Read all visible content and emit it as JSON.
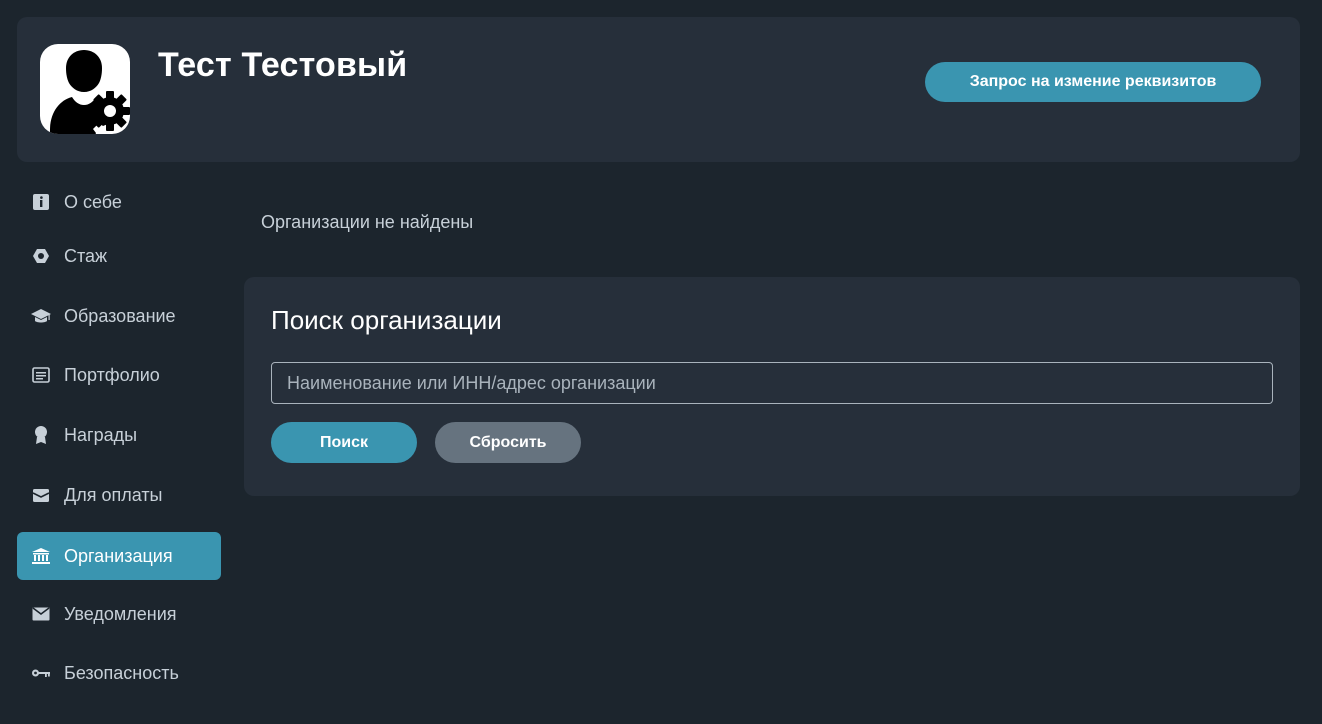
{
  "header": {
    "user_name": "Тест Тестовый",
    "request_button": "Запрос на измение реквизитов",
    "avatar_icon": "user-settings-icon"
  },
  "sidebar": {
    "items": [
      {
        "label": "О себе",
        "icon": "info-icon"
      },
      {
        "label": "Стаж",
        "icon": "hexagon-icon"
      },
      {
        "label": "Образование",
        "icon": "graduation-cap-icon"
      },
      {
        "label": "Портфолио",
        "icon": "document-icon"
      },
      {
        "label": "Награды",
        "icon": "award-icon"
      },
      {
        "label": "Для оплаты",
        "icon": "wallet-icon"
      },
      {
        "label": "Организация",
        "icon": "bank-icon",
        "active": true
      },
      {
        "label": "Уведомления",
        "icon": "envelope-icon"
      },
      {
        "label": "Безопасность",
        "icon": "key-icon"
      }
    ]
  },
  "main": {
    "empty_message": "Организации не найдены",
    "search_panel": {
      "title": "Поиск организации",
      "input_placeholder": "Наименование или ИНН/адрес организации",
      "input_value": "",
      "search_button": "Поиск",
      "reset_button": "Сбросить"
    }
  },
  "colors": {
    "background": "#1c252d",
    "panel": "#262f3a",
    "accent": "#3a95b0",
    "secondary_button": "#66737f"
  }
}
